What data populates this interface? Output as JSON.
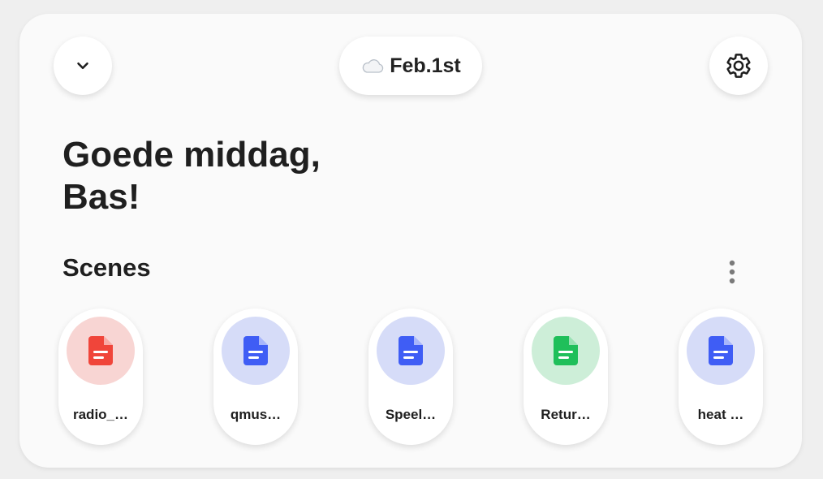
{
  "header": {
    "collapse_icon": "chevron-down-icon",
    "weather_icon": "cloud-icon",
    "date": "Feb.1st",
    "settings_icon": "gear-icon"
  },
  "greeting": {
    "line1": "Goede middag,",
    "line2": "Bas!"
  },
  "scenes_section": {
    "title": "Scenes",
    "more_icon": "more-vertical-icon",
    "items": [
      {
        "label": "radio_…",
        "icon": "file-document-icon",
        "color": "#f0453a",
        "bg": "#f8d5d3"
      },
      {
        "label": "qmus…",
        "icon": "file-document-icon",
        "color": "#3f5df5",
        "bg": "#d6dcf8"
      },
      {
        "label": "Speel…",
        "icon": "file-document-icon",
        "color": "#3f5df5",
        "bg": "#d6dcf8"
      },
      {
        "label": "Retur…",
        "icon": "file-document-icon",
        "color": "#1fbf5a",
        "bg": "#cdeed8"
      },
      {
        "label": "heat …",
        "icon": "file-document-icon",
        "color": "#3f5df5",
        "bg": "#d6dcf8"
      }
    ]
  }
}
